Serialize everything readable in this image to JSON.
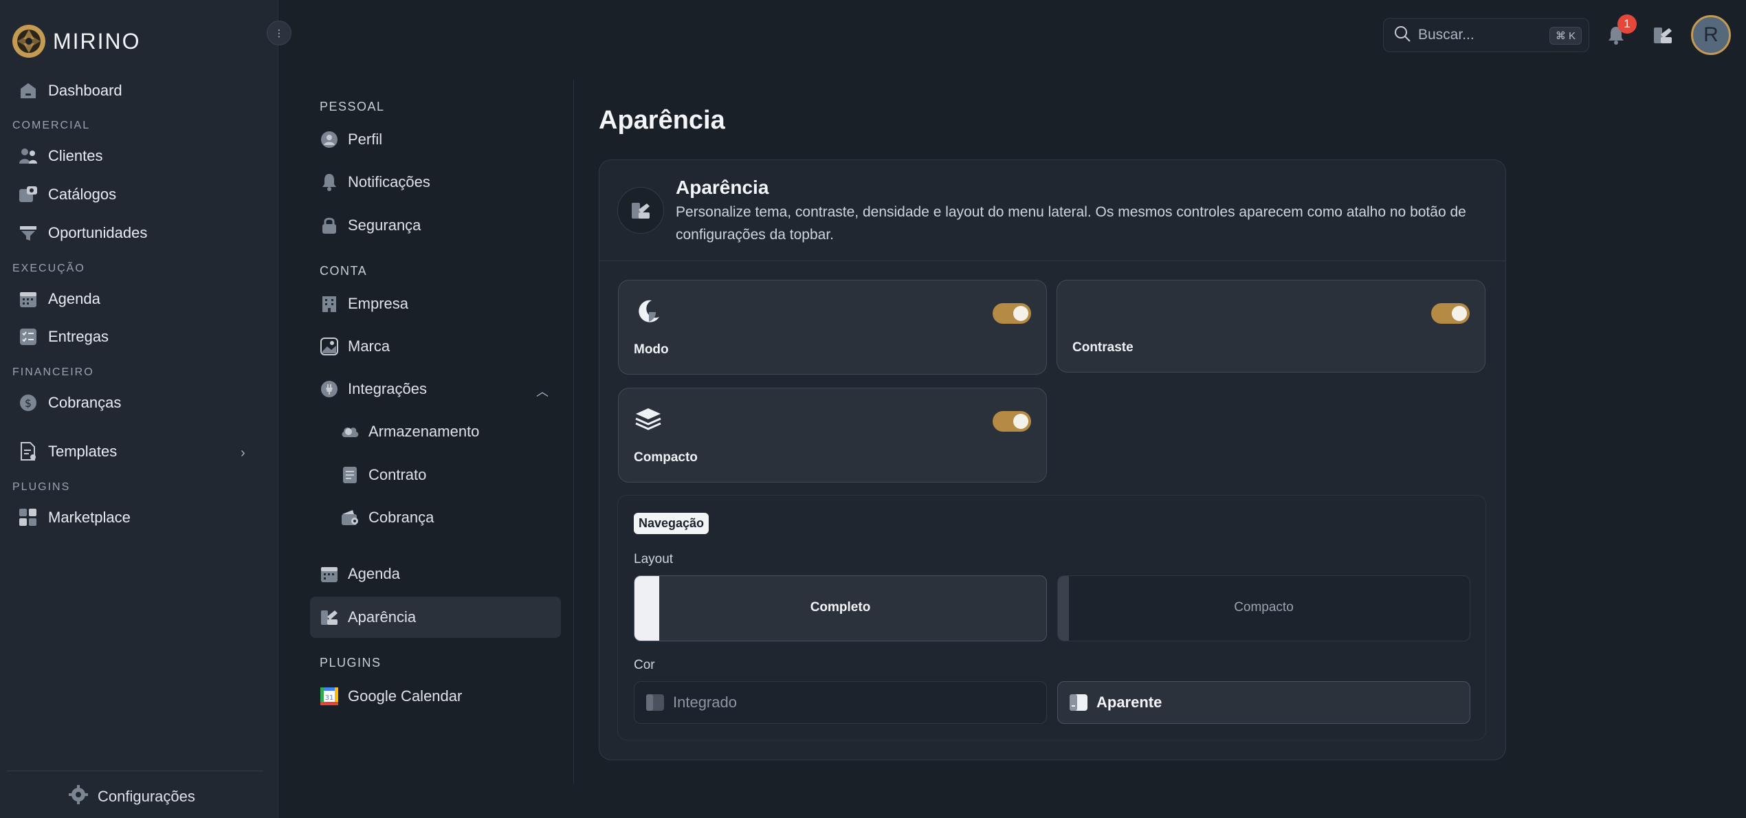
{
  "app": {
    "name": "MIRINO"
  },
  "sidebar": {
    "dashboard": "Dashboard",
    "sections": {
      "comercial": "COMERCIAL",
      "execucao": "EXECUÇÃO",
      "financeiro": "FINANCEIRO",
      "plugins": "PLUGINS"
    },
    "items": {
      "clientes": "Clientes",
      "catalogos": "Catálogos",
      "oportunidades": "Oportunidades",
      "agenda": "Agenda",
      "entregas": "Entregas",
      "cobrancas": "Cobranças",
      "templates": "Templates",
      "marketplace": "Marketplace"
    },
    "footer": "Configurações"
  },
  "topbar": {
    "search_placeholder": "Buscar...",
    "shortcut": "⌘ K",
    "notifications_count": "1",
    "avatar_initial": "R"
  },
  "settings_nav": {
    "pessoal": "PESSOAL",
    "perfil": "Perfil",
    "notificacoes": "Notificações",
    "seguranca": "Segurança",
    "conta": "CONTA",
    "empresa": "Empresa",
    "marca": "Marca",
    "integracoes": "Integrações",
    "armazenamento": "Armazenamento",
    "contrato": "Contrato",
    "cobranca": "Cobrança",
    "agenda": "Agenda",
    "aparencia": "Aparência",
    "plugins": "PLUGINS",
    "google_calendar": "Google Calendar"
  },
  "main": {
    "title": "Aparência",
    "card": {
      "title": "Aparência",
      "description": "Personalize tema, contraste, densidade e layout do menu lateral. Os mesmos controles aparecem como atalho no botão de configurações da topbar."
    },
    "toggles": [
      {
        "label": "Modo",
        "on": true
      },
      {
        "label": "Contraste",
        "on": true
      },
      {
        "label": "Compacto",
        "on": true
      }
    ],
    "navigation": {
      "pill": "Navegação",
      "layout_label": "Layout",
      "layout_options": [
        "Completo",
        "Compacto"
      ],
      "layout_selected": "Completo",
      "color_label": "Cor",
      "color_options": [
        "Integrado",
        "Aparente"
      ],
      "color_selected": "Aparente"
    }
  },
  "colors": {
    "accent": "#b58a44",
    "badge": "#e5483b",
    "bg": "#1a2028",
    "sidebar": "#212832"
  }
}
